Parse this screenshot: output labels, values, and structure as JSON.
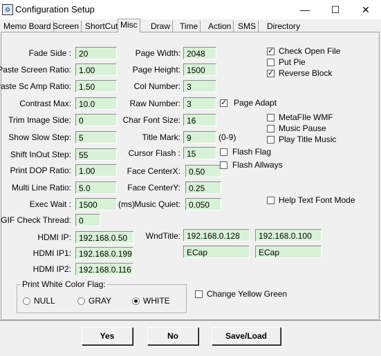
{
  "window": {
    "title": "Configuration Setup",
    "minimize_glyph": "—",
    "maximize_glyph": "☐",
    "close_glyph": "✕"
  },
  "tabs": [
    {
      "label": "Memo Board"
    },
    {
      "label": "Screen"
    },
    {
      "label": "ShortCut"
    },
    {
      "label": "Misc"
    },
    {
      "label": "Draw"
    },
    {
      "label": "Time"
    },
    {
      "label": "Action"
    },
    {
      "label": "SMS"
    },
    {
      "label": "Directory"
    }
  ],
  "left_fields": [
    {
      "label": "Fade Side :",
      "value": "20"
    },
    {
      "label": "Paste Screen Ratio:",
      "value": "1.00"
    },
    {
      "label": "Paste Sc Amp Ratio:",
      "value": "1.50"
    },
    {
      "label": "Contrast Max:",
      "value": "10.0"
    },
    {
      "label": "Trim Image Side:",
      "value": "0"
    },
    {
      "label": "Show Slow Step:",
      "value": "5"
    },
    {
      "label": "Shift InOut Step:",
      "value": "55"
    },
    {
      "label": "Print DOP Ratio:",
      "value": "1.00"
    },
    {
      "label": "Multi Line Ratio:",
      "value": "5.0"
    },
    {
      "label": "Exec Wait :",
      "value": "1500",
      "suffix": "(ms)"
    },
    {
      "label": "GIF Check Thread:",
      "value": "0"
    },
    {
      "label": "HDMI IP:",
      "value": "192.168.0.50"
    },
    {
      "label": "HDMI IP1:",
      "value": "192.168.0.199"
    },
    {
      "label": "HDMI IP2:",
      "value": "192.168.0.116"
    }
  ],
  "mid_fields": [
    {
      "label": "Page Width:",
      "value": "2048"
    },
    {
      "label": "Page Height:",
      "value": "1500"
    },
    {
      "label": "Col Number:",
      "value": "3"
    },
    {
      "label": "Raw Number:",
      "value": "3"
    },
    {
      "label": "Char Font Size:",
      "value": "16"
    },
    {
      "label": "Title Mark:",
      "value": "9",
      "suffix": "(0-9)"
    },
    {
      "label": "Cursor Flash :",
      "value": "15"
    },
    {
      "label": "Face CenterX:",
      "value": "0.50"
    },
    {
      "label": "Face CenterY:",
      "value": "0.25"
    },
    {
      "label": "Music Quiet:",
      "value": "0.050"
    }
  ],
  "wnd_title": {
    "label": "WndTitle:",
    "values": [
      "192.168.0.128",
      "192.168.0.100",
      "ECap",
      "ECap"
    ]
  },
  "checkboxes_right_top": [
    {
      "label": "Check Open File",
      "checked": true
    },
    {
      "label": "Put Pie",
      "checked": false
    },
    {
      "label": "Reverse Block",
      "checked": true
    }
  ],
  "page_adapt": {
    "label": "Page Adapt",
    "checked": true
  },
  "checkboxes_right_mid": [
    {
      "label": "MetaFIle WMF",
      "checked": false
    },
    {
      "label": "Music Pause",
      "checked": false
    },
    {
      "label": "Play Title Music",
      "checked": false
    }
  ],
  "flash_flag": {
    "label": "Flash Flag",
    "checked": false
  },
  "flash_allways": {
    "label": "Flash Allways",
    "checked": false
  },
  "help_title_font": {
    "label": "Help Text Font Mode",
    "checked": false
  },
  "change_yellow_green": {
    "label": "Change Yellow Green",
    "checked": false
  },
  "print_white_color": {
    "title": "Print White Color Flag:",
    "options": [
      {
        "label": "NULL",
        "selected": false
      },
      {
        "label": "GRAY",
        "selected": false
      },
      {
        "label": "WHITE",
        "selected": true
      }
    ]
  },
  "buttons": {
    "yes": "Yes",
    "no": "No",
    "save_load": "Save/Load"
  },
  "colors": {
    "field_bg": "#d8f2d8",
    "window_bg": "#f0f0f0"
  }
}
